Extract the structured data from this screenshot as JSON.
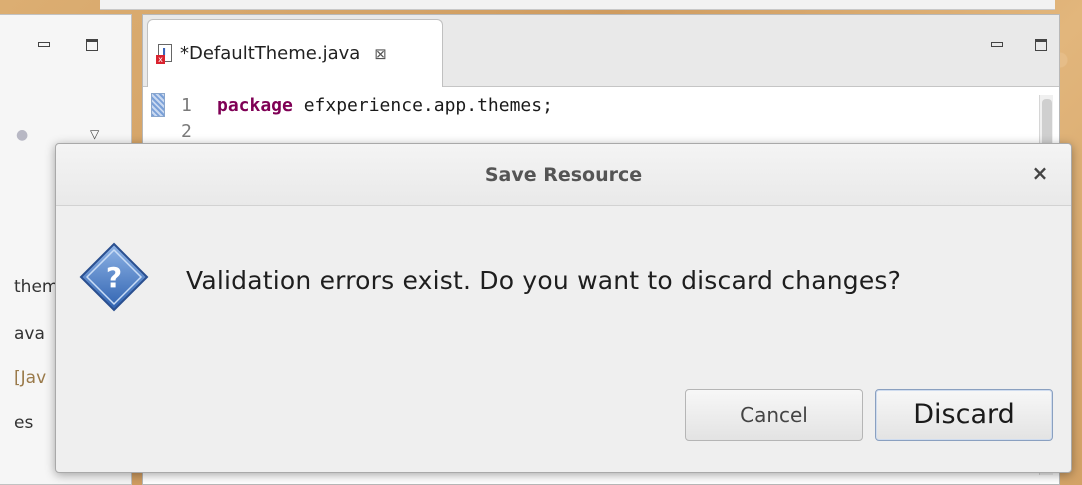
{
  "editor": {
    "tab_label": "*DefaultTheme.java",
    "tab_close_glyph": "⊠",
    "line_numbers": [
      "1",
      "2"
    ],
    "code_keyword": "package",
    "code_rest": " efxperience.app.themes;"
  },
  "left_view": {
    "tree_items": [
      "them",
      "ava",
      "[Jav",
      "es"
    ]
  },
  "dialog": {
    "title": "Save Resource",
    "close_glyph": "×",
    "message": "Validation errors exist. Do you want to discard changes?",
    "cancel_label": "Cancel",
    "discard_label": "Discard",
    "icon": "question-icon"
  },
  "colors": {
    "keyword": "#7f0055",
    "icon_blue": "#3f73c2",
    "error_red": "#d9232f"
  }
}
